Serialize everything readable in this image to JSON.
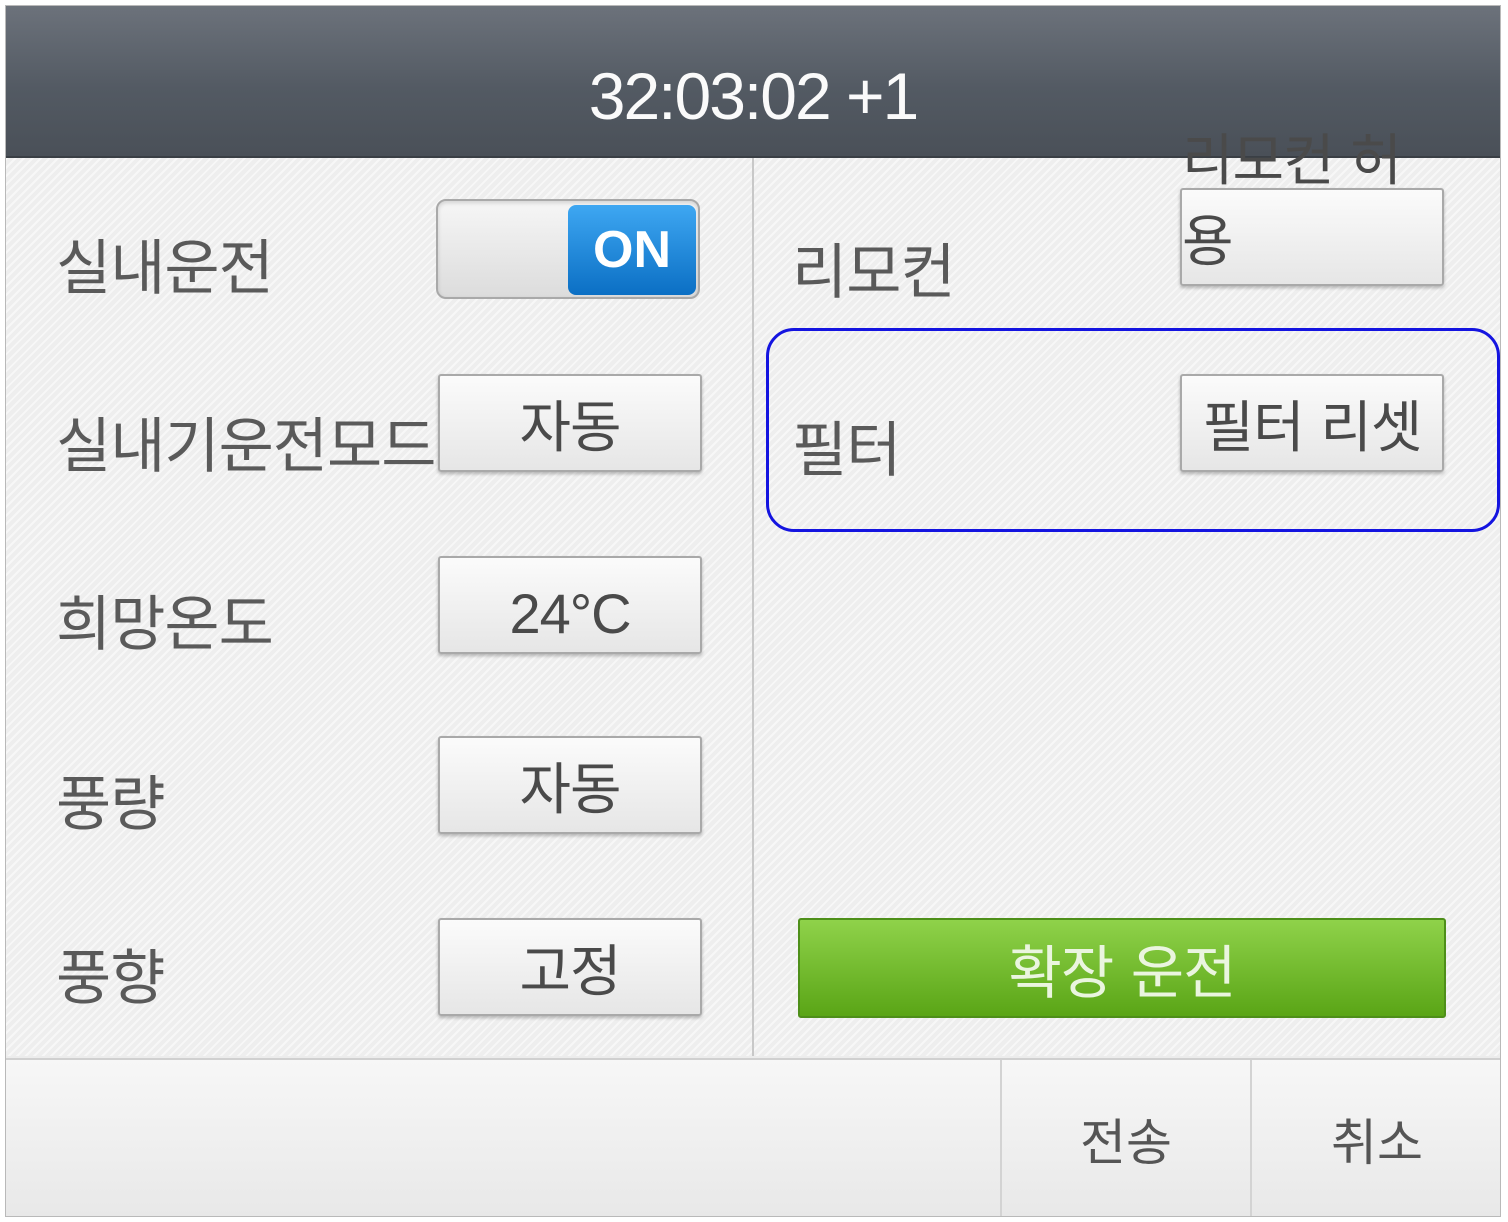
{
  "header": {
    "clock": "32:03:02 +1"
  },
  "left": {
    "indoor_operation": {
      "label": "실내운전",
      "toggle_value": "ON"
    },
    "indoor_mode": {
      "label": "실내기운전모드",
      "value": "자동"
    },
    "target_temp": {
      "label": "희망온도",
      "value": "24°C"
    },
    "fan_speed": {
      "label": "풍량",
      "value": "자동"
    },
    "fan_direction": {
      "label": "풍향",
      "value": "고정"
    }
  },
  "right": {
    "remote": {
      "label": "리모컨",
      "button": "리모컨 허용"
    },
    "filter": {
      "label": "필터",
      "button": "필터 리셋"
    },
    "extended_button": "확장 운전"
  },
  "footer": {
    "send": "전송",
    "cancel": "취소"
  },
  "colors": {
    "header": "#555c65",
    "toggle_on": "#1a86dc",
    "extended_green": "#6fbb2a",
    "highlight_border": "#1414e0"
  }
}
